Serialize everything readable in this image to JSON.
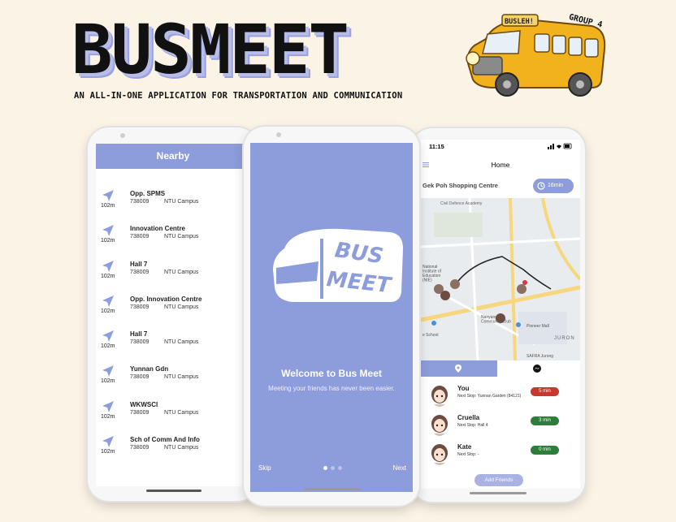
{
  "app": {
    "title": "BUSMEET",
    "subtitle": "AN ALL-IN-ONE APPLICATION FOR TRANSPORTATION AND COMMUNICATION",
    "bus_logo": {
      "sign_text": "BUSLEH!",
      "badge_text": "GROUP 4"
    }
  },
  "colors": {
    "accent": "#8d9ddb",
    "background": "#fbf3e6",
    "red": "#c8382f",
    "green": "#2e7d3a"
  },
  "nearby": {
    "header": "Nearby",
    "items": [
      {
        "distance": "102m",
        "name": "Opp. SPMS",
        "code": "738009",
        "campus": "NTU Campus"
      },
      {
        "distance": "102m",
        "name": "Innovation Centre",
        "code": "738009",
        "campus": "NTU Campus"
      },
      {
        "distance": "102m",
        "name": "Hall 7",
        "code": "738009",
        "campus": "NTU Campus"
      },
      {
        "distance": "102m",
        "name": "Opp. Innovation Centre",
        "code": "738009",
        "campus": "NTU Campus"
      },
      {
        "distance": "102m",
        "name": "Hall 7",
        "code": "738009",
        "campus": "NTU Campus"
      },
      {
        "distance": "102m",
        "name": "Yunnan Gdn",
        "code": "738009",
        "campus": "NTU Campus"
      },
      {
        "distance": "102m",
        "name": "WKWSCI",
        "code": "738009",
        "campus": "NTU Campus"
      },
      {
        "distance": "102m",
        "name": "Sch of Comm And Info",
        "code": "738009",
        "campus": "NTU Campus"
      }
    ]
  },
  "welcome": {
    "logo_line1": "BUS",
    "logo_line2": "MEET",
    "title": "Welcome to Bus Meet",
    "tagline": "Meeting your friends has never been easier.",
    "skip": "Skip",
    "next": "Next",
    "page_index": 0,
    "page_count": 3
  },
  "home": {
    "time": "11:15",
    "title": "Home",
    "location": "Gek Poh Shopping Centre",
    "eta": "16min",
    "map_labels": {
      "academy": "Civil Defence Academy",
      "nie": "National\nInstitute of\nEducation\n(NIE)",
      "club": "Nanyang\nCommunity Club",
      "mall": "Pioneer Mall",
      "school": "e School",
      "jurong": "JURON",
      "mart": "Sheng Siong\nSupermarket",
      "road": "Jurong West Ave 1",
      "safra": "SAFRA Jurong"
    },
    "friends": [
      {
        "name": "You",
        "stop": "Next Stop: Yunnan Garden (84121)",
        "time": "5 min",
        "color": "#c8382f"
      },
      {
        "name": "Cruella",
        "stop": "Next Stop: Hall 4",
        "time": "3 min",
        "color": "#2e7d3a"
      },
      {
        "name": "Kate",
        "stop": "Next Stop: -",
        "time": "0 min",
        "color": "#2e7d3a"
      }
    ],
    "add_friends": "Add Friends"
  }
}
